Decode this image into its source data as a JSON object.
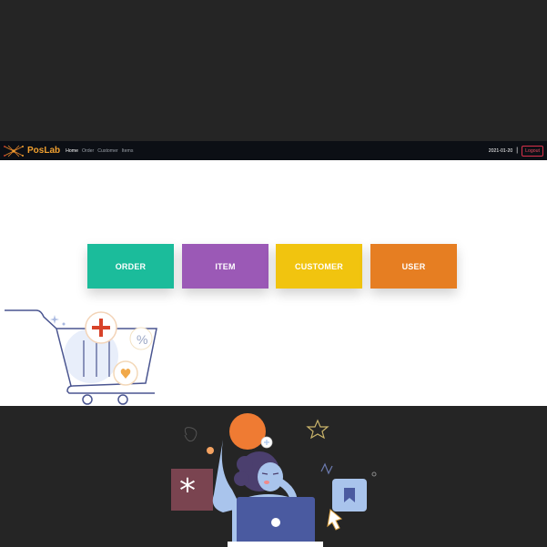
{
  "navbar": {
    "brand": "PosLab",
    "links": [
      "Home",
      "Order",
      "Customer",
      "Items"
    ],
    "date": "2021-01-20",
    "separator": "|",
    "logout": "Logout"
  },
  "tiles": [
    "ORDER",
    "ITEM",
    "CUSTOMER",
    "USER"
  ],
  "colors": {
    "order": "#1bbc9b",
    "item": "#9b59b6",
    "customer": "#f1c40f",
    "user": "#e67e22",
    "navbar": "#0c0f15",
    "logout": "#d9304a"
  },
  "icons": [
    "logo-icon",
    "shopping-cart-illustration",
    "person-laptop-illustration"
  ]
}
